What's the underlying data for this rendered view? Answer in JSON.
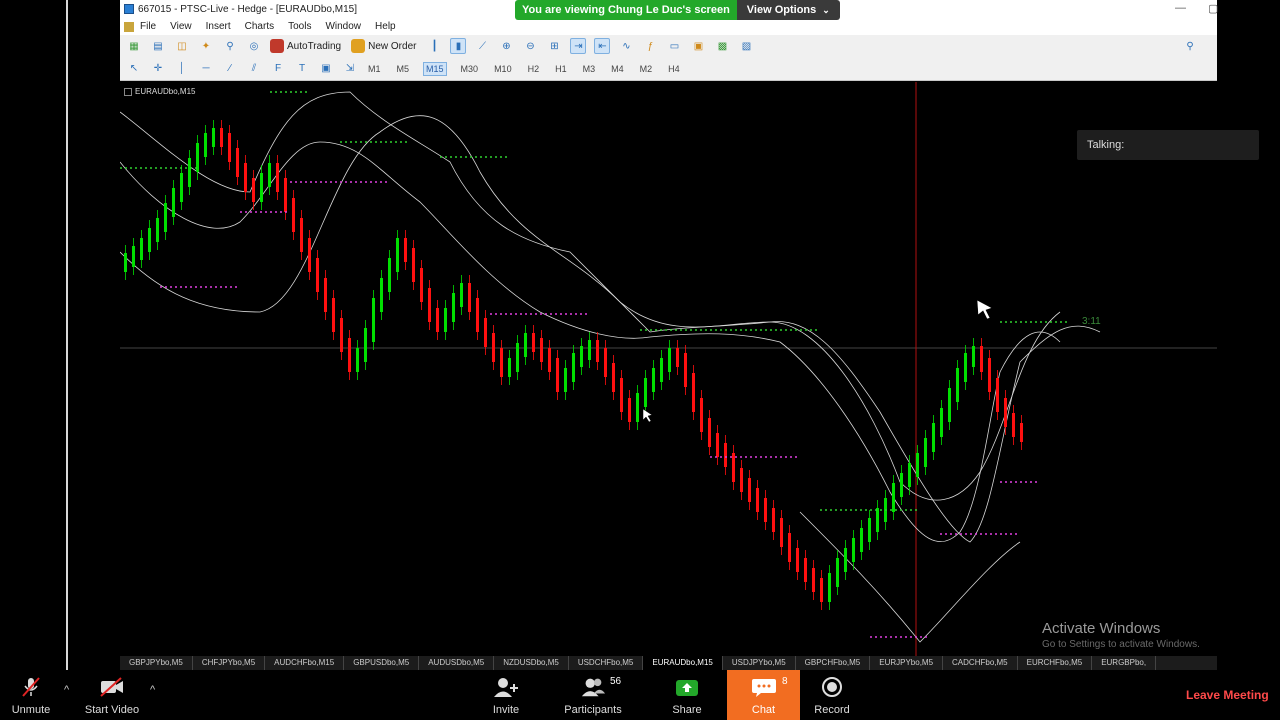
{
  "zoom_banner": {
    "viewing_text": "You are viewing Chung Le Duc's screen",
    "view_options": "View Options"
  },
  "mt4": {
    "title": "667015 - PTSC-Live - Hedge - [EURAUDbo,M15]",
    "menu": [
      "File",
      "View",
      "Insert",
      "Charts",
      "Tools",
      "Window",
      "Help"
    ],
    "toolbar": {
      "autotrading": "AutoTrading",
      "new_order": "New Order"
    },
    "periods": [
      "M1",
      "M5",
      "M15",
      "M30",
      "M10",
      "H2",
      "H1",
      "M3",
      "M4",
      "M2",
      "H4"
    ],
    "active_period": "M15",
    "chart_label": "EURAUDbo,M15",
    "countdown": "3:11",
    "tabs": [
      "GBPJPYbo,M5",
      "CHFJPYbo,M5",
      "AUDCHFbo,M15",
      "GBPUSDbo,M5",
      "AUDUSDbo,M5",
      "NZDUSDbo,M5",
      "USDCHFbo,M5",
      "EURAUDbo,M15",
      "USDJPYbo,M5",
      "GBPCHFbo,M5",
      "EURJPYbo,M5",
      "CADCHFbo,M5",
      "EURCHFbo,M5",
      "EURGBPbo,"
    ],
    "active_tab": "EURAUDbo,M15"
  },
  "talking": {
    "label": "Talking:"
  },
  "activate": {
    "line1": "Activate Windows",
    "line2": "Go to Settings to activate Windows."
  },
  "zoom_bar": {
    "unmute": "Unmute",
    "start_video": "Start Video",
    "invite": "Invite",
    "participants": "Participants",
    "participants_count": "56",
    "share": "Share",
    "chat": "Chat",
    "chat_count": "8",
    "record": "Record",
    "leave": "Leave Meeting"
  },
  "colors": {
    "bull_candle": "#00e000",
    "bear_candle": "#ff1010",
    "band_line": "#d8d8d8",
    "zoom_green": "#23a82a",
    "chat_orange": "#f26d21",
    "leave_red": "#ff4a4a"
  }
}
